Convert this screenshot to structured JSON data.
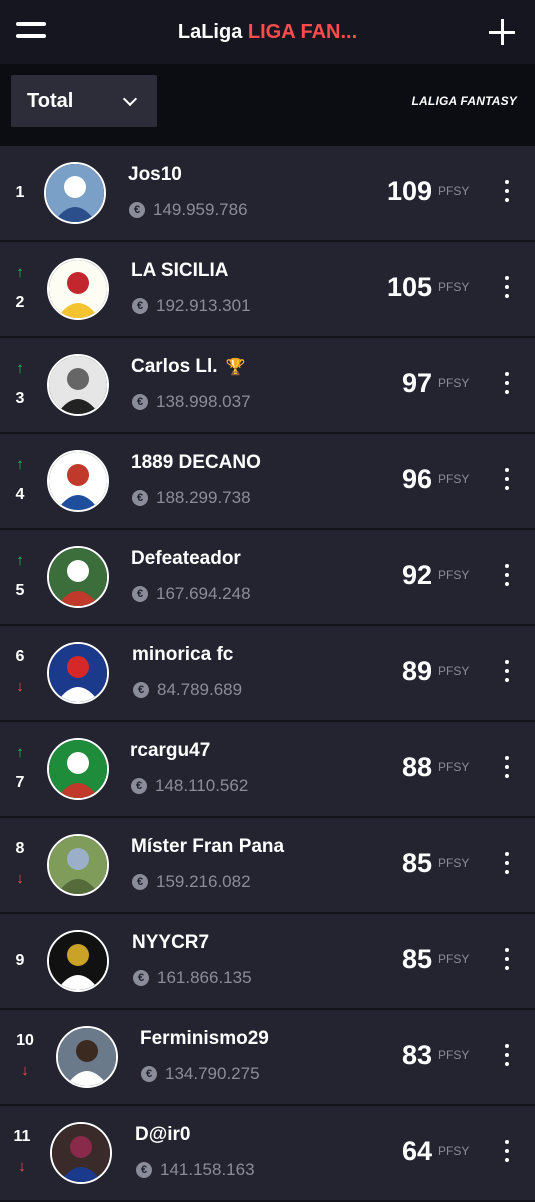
{
  "header": {
    "title_main": "LaLiga",
    "title_accent": "LIGA FAN...",
    "menu_icon": "hamburger-menu-icon",
    "add_icon": "plus-icon"
  },
  "filter": {
    "selected": "Total",
    "brand": "LALIGA FANTASY"
  },
  "colors": {
    "accent": "#ff4b4b",
    "up": "#27c25c",
    "down": "#f05252",
    "row_bg": "#232430"
  },
  "unit_label": "PFSY",
  "coin_symbol": "€",
  "rows": [
    {
      "rank": "1",
      "trend": "none",
      "name": "Jos10",
      "value": "149.959.786",
      "points": "109",
      "trophy": false
    },
    {
      "rank": "2",
      "trend": "up",
      "name": "LA SICILIA",
      "value": "192.913.301",
      "points": "105",
      "trophy": false
    },
    {
      "rank": "3",
      "trend": "up",
      "name": "Carlos Ll.",
      "value": "138.998.037",
      "points": "97",
      "trophy": true
    },
    {
      "rank": "4",
      "trend": "up",
      "name": "1889 DECANO",
      "value": "188.299.738",
      "points": "96",
      "trophy": false
    },
    {
      "rank": "5",
      "trend": "up",
      "name": "Defeateador",
      "value": "167.694.248",
      "points": "92",
      "trophy": false
    },
    {
      "rank": "6",
      "trend": "down",
      "name": "minorica fc",
      "value": "84.789.689",
      "points": "89",
      "trophy": false
    },
    {
      "rank": "7",
      "trend": "up",
      "name": "rcargu47",
      "value": "148.110.562",
      "points": "88",
      "trophy": false
    },
    {
      "rank": "8",
      "trend": "down",
      "name": "Míster Fran Pana",
      "value": "159.216.082",
      "points": "85",
      "trophy": false
    },
    {
      "rank": "9",
      "trend": "none",
      "name": "NYYCR7",
      "value": "161.866.135",
      "points": "85",
      "trophy": false
    },
    {
      "rank": "10",
      "trend": "down",
      "name": "Ferminismo29",
      "value": "134.790.275",
      "points": "83",
      "trophy": false
    },
    {
      "rank": "11",
      "trend": "down",
      "name": "D@ir0",
      "value": "141.158.163",
      "points": "64",
      "trophy": false
    }
  ]
}
